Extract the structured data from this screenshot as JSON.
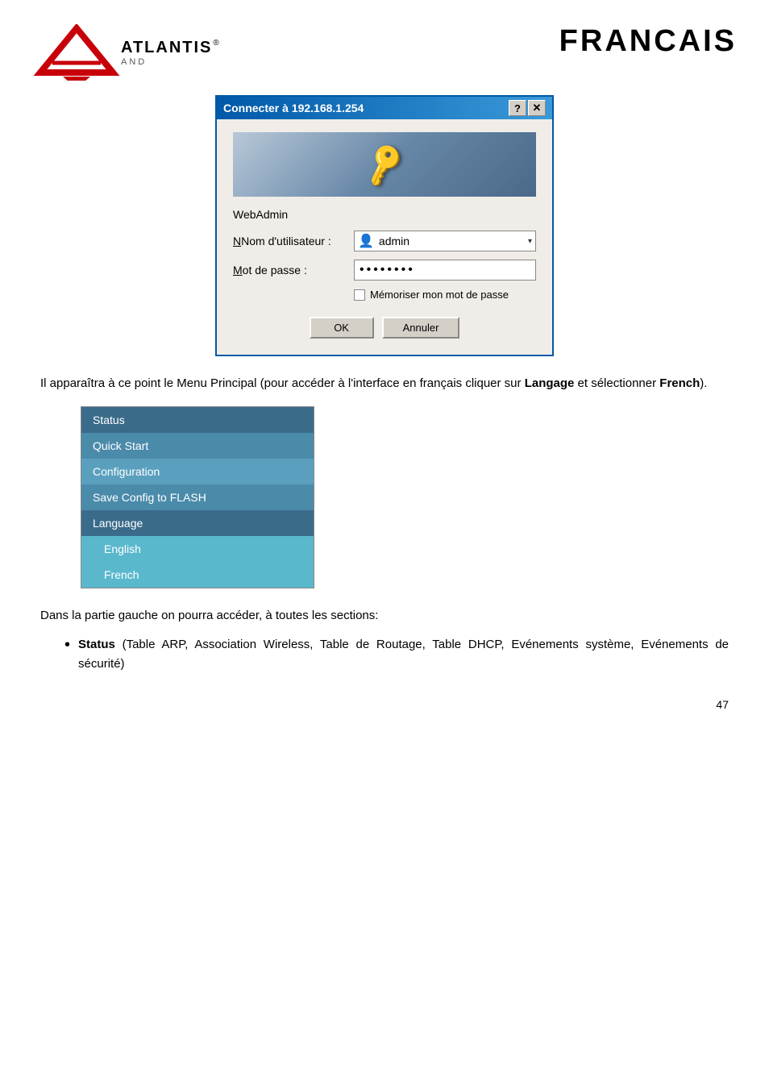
{
  "header": {
    "brand": "ATLANTIS",
    "registered": "®",
    "and": "AND",
    "title": "FRANCAIS"
  },
  "dialog": {
    "title": "Connecter à 192.168.1.254",
    "help_btn": "?",
    "close_btn": "✕",
    "webadmin_label": "WebAdmin",
    "username_label": "Nom d'utilisateur :",
    "username_value": "admin",
    "password_label": "Mot de passe :",
    "password_value": "••••••••",
    "remember_label": "Mémoriser mon mot de passe",
    "ok_btn": "OK",
    "cancel_btn": "Annuler"
  },
  "body_paragraph": "Il apparaîtra à ce point le Menu Principal (pour accéder à l'interface en français cliquer sur ",
  "body_bold1": "Langage",
  "body_mid": " et sélectionner ",
  "body_bold2": "French",
  "body_end": ").",
  "nav_menu": {
    "items": [
      {
        "label": "Status",
        "style": "dark"
      },
      {
        "label": "Quick Start",
        "style": "medium"
      },
      {
        "label": "Configuration",
        "style": "medium"
      },
      {
        "label": "Save Config to FLASH",
        "style": "medium"
      },
      {
        "label": "Language",
        "style": "medium"
      },
      {
        "label": "English",
        "style": "sub"
      },
      {
        "label": "French",
        "style": "sub"
      }
    ]
  },
  "bottom_text": "Dans la partie gauche on pourra accéder, à toutes les sections:",
  "bullet": {
    "dot": "•",
    "bold_part": "Status",
    "rest": " (Table ARP, Association Wireless, Table de Routage, Table DHCP, Evénements système, Evénements de sécurité)"
  },
  "page_number": "47"
}
